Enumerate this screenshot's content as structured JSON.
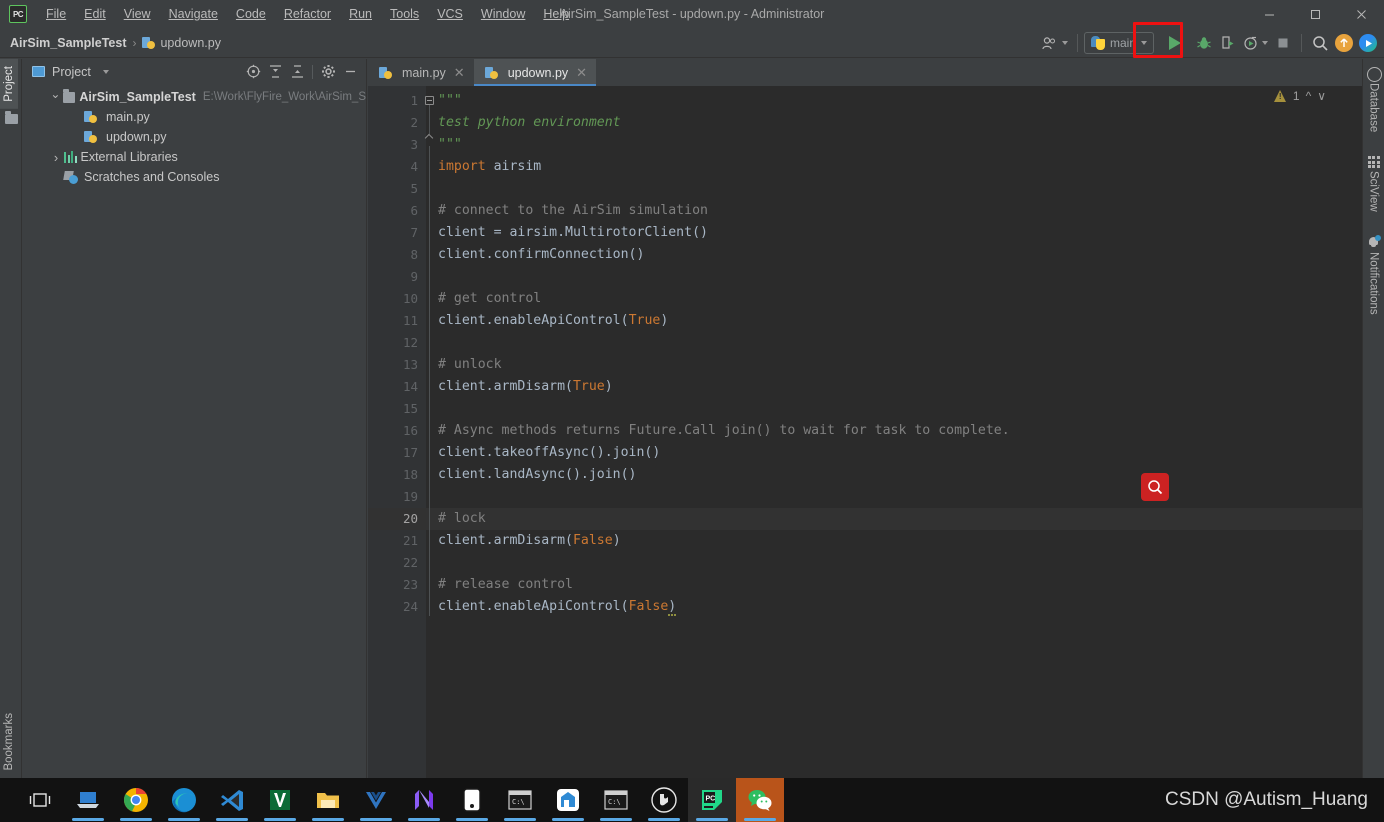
{
  "window": {
    "title": "AirSim_SampleTest - updown.py - Administrator",
    "logo_text": "PC",
    "minimize_label": "Minimize",
    "maximize_label": "Maximize",
    "close_label": "Close"
  },
  "menu": {
    "items": [
      {
        "label": "File"
      },
      {
        "label": "Edit"
      },
      {
        "label": "View"
      },
      {
        "label": "Navigate"
      },
      {
        "label": "Code"
      },
      {
        "label": "Refactor"
      },
      {
        "label": "Run"
      },
      {
        "label": "Tools"
      },
      {
        "label": "VCS"
      },
      {
        "label": "Window"
      },
      {
        "label": "Help"
      }
    ]
  },
  "breadcrumb": {
    "project": "AirSim_SampleTest",
    "separator": "›",
    "file": "updown.py"
  },
  "toolbar": {
    "run_config": "main",
    "run_config_icon": "python-icon",
    "user_icon": "user-icon",
    "run_label": "Run",
    "debug_label": "Debug",
    "coverage_label": "Run with Coverage",
    "profile_label": "Profile",
    "stop_label": "Stop",
    "search_label": "Search Everywhere",
    "update_label": "Update Project",
    "share_label": "Share",
    "highlight_color": "#ee1111"
  },
  "left_strip": {
    "tabs": [
      {
        "label": "Project",
        "active": true
      },
      {
        "label": "Bookmarks",
        "active": false
      }
    ]
  },
  "project_panel": {
    "title": "Project",
    "tools": [
      {
        "name": "select-opened-file-icon"
      },
      {
        "name": "expand-all-icon"
      },
      {
        "name": "collapse-all-icon"
      },
      {
        "name": "settings-gear-icon"
      },
      {
        "name": "hide-panel-icon"
      }
    ],
    "tree": [
      {
        "label": "AirSim_SampleTest",
        "path": "E:\\Work\\FlyFire_Work\\AirSim_S",
        "icon": "folder-icon",
        "state": "open",
        "depth": 0,
        "bold": true
      },
      {
        "label": "main.py",
        "path": "",
        "icon": "python-file-icon",
        "state": "leaf",
        "depth": 1,
        "bold": false
      },
      {
        "label": "updown.py",
        "path": "",
        "icon": "python-file-icon",
        "state": "leaf",
        "depth": 1,
        "bold": false
      },
      {
        "label": "External Libraries",
        "path": "",
        "icon": "libraries-icon",
        "state": "closed",
        "depth": 0,
        "bold": false
      },
      {
        "label": "Scratches and Consoles",
        "path": "",
        "icon": "scratches-icon",
        "state": "leaf",
        "depth": 0,
        "bold": false
      }
    ]
  },
  "editor": {
    "tabs": [
      {
        "label": "main.py",
        "active": false
      },
      {
        "label": "updown.py",
        "active": true
      }
    ],
    "current_line": 20,
    "inspection": {
      "warnings": "1",
      "icon": "warning-triangle-icon"
    },
    "cursor_icon": "search-cursor-icon",
    "lines": [
      {
        "n": 1,
        "tokens": [
          {
            "t": "\"\"\"",
            "c": "doc"
          }
        ]
      },
      {
        "n": 2,
        "tokens": [
          {
            "t": "test python environment",
            "c": "doc"
          }
        ]
      },
      {
        "n": 3,
        "tokens": [
          {
            "t": "\"\"\"",
            "c": "doc"
          }
        ]
      },
      {
        "n": 4,
        "tokens": [
          {
            "t": "import",
            "c": "kw"
          },
          {
            "t": " airsim",
            "c": "txt"
          }
        ]
      },
      {
        "n": 5,
        "tokens": []
      },
      {
        "n": 6,
        "tokens": [
          {
            "t": "# connect to the AirSim simulation",
            "c": "cm"
          }
        ]
      },
      {
        "n": 7,
        "tokens": [
          {
            "t": "client = airsim.MultirotorClient()",
            "c": "txt"
          }
        ]
      },
      {
        "n": 8,
        "tokens": [
          {
            "t": "client.confirmConnection()",
            "c": "txt"
          }
        ]
      },
      {
        "n": 9,
        "tokens": []
      },
      {
        "n": 10,
        "tokens": [
          {
            "t": "# get control",
            "c": "cm"
          }
        ]
      },
      {
        "n": 11,
        "tokens": [
          {
            "t": "client.enableApiControl(",
            "c": "txt"
          },
          {
            "t": "True",
            "c": "kw"
          },
          {
            "t": ")",
            "c": "txt"
          }
        ]
      },
      {
        "n": 12,
        "tokens": []
      },
      {
        "n": 13,
        "tokens": [
          {
            "t": "# unlock",
            "c": "cm"
          }
        ]
      },
      {
        "n": 14,
        "tokens": [
          {
            "t": "client.armDisarm(",
            "c": "txt"
          },
          {
            "t": "True",
            "c": "kw"
          },
          {
            "t": ")",
            "c": "txt"
          }
        ]
      },
      {
        "n": 15,
        "tokens": []
      },
      {
        "n": 16,
        "tokens": [
          {
            "t": "# Async methods returns Future.Call join() to wait for task to complete.",
            "c": "cm"
          }
        ]
      },
      {
        "n": 17,
        "tokens": [
          {
            "t": "client.takeoffAsync().join()",
            "c": "txt"
          }
        ]
      },
      {
        "n": 18,
        "tokens": [
          {
            "t": "client.landAsync().join()",
            "c": "txt"
          }
        ]
      },
      {
        "n": 19,
        "tokens": []
      },
      {
        "n": 20,
        "tokens": [
          {
            "t": "# lock",
            "c": "cm"
          }
        ]
      },
      {
        "n": 21,
        "tokens": [
          {
            "t": "client.armDisarm(",
            "c": "txt"
          },
          {
            "t": "False",
            "c": "kw"
          },
          {
            "t": ")",
            "c": "txt"
          }
        ]
      },
      {
        "n": 22,
        "tokens": []
      },
      {
        "n": 23,
        "tokens": [
          {
            "t": "# release control",
            "c": "cm"
          }
        ]
      },
      {
        "n": 24,
        "tokens": [
          {
            "t": "client.enableApiControl(",
            "c": "txt"
          },
          {
            "t": "False",
            "c": "kw"
          },
          {
            "t": ")",
            "c": "txt"
          }
        ]
      }
    ],
    "colors": {
      "background": "#2b2b2b",
      "gutter": "#313335",
      "text": "#a9b7c6",
      "keyword": "#cc7832",
      "comment": "#808080",
      "docstring": "#629755",
      "current_line": "#323232"
    }
  },
  "right_strip": {
    "tabs": [
      {
        "label": "Database",
        "icon": "database-icon",
        "badge": false
      },
      {
        "label": "SciView",
        "icon": "sciview-icon",
        "badge": false
      },
      {
        "label": "Notifications",
        "icon": "bell-icon",
        "badge": true
      }
    ]
  },
  "taskbar": {
    "watermark": "CSDN @Autism_Huang",
    "items": [
      {
        "name": "task-view-icon",
        "running": false,
        "active": false
      },
      {
        "name": "presentation-icon",
        "running": true,
        "active": false
      },
      {
        "name": "chrome-icon",
        "running": true,
        "active": false
      },
      {
        "name": "edge-icon",
        "running": true,
        "active": false
      },
      {
        "name": "vscode-icon",
        "running": true,
        "active": false
      },
      {
        "name": "visual-studio-installer-icon",
        "running": true,
        "active": false
      },
      {
        "name": "file-explorer-icon",
        "running": true,
        "active": false
      },
      {
        "name": "vuejs-icon",
        "running": true,
        "active": false
      },
      {
        "name": "neovim-icon",
        "running": true,
        "active": false
      },
      {
        "name": "terminal-dark-icon",
        "running": true,
        "active": false
      },
      {
        "name": "cmd-icon",
        "running": true,
        "active": false
      },
      {
        "name": "todo-app-icon",
        "running": true,
        "active": false
      },
      {
        "name": "cmd2-icon",
        "running": true,
        "active": false
      },
      {
        "name": "unreal-engine-icon",
        "running": true,
        "active": false
      },
      {
        "name": "pycharm-icon",
        "running": true,
        "active": true
      },
      {
        "name": "wechat-icon",
        "running": true,
        "active": true
      }
    ]
  }
}
